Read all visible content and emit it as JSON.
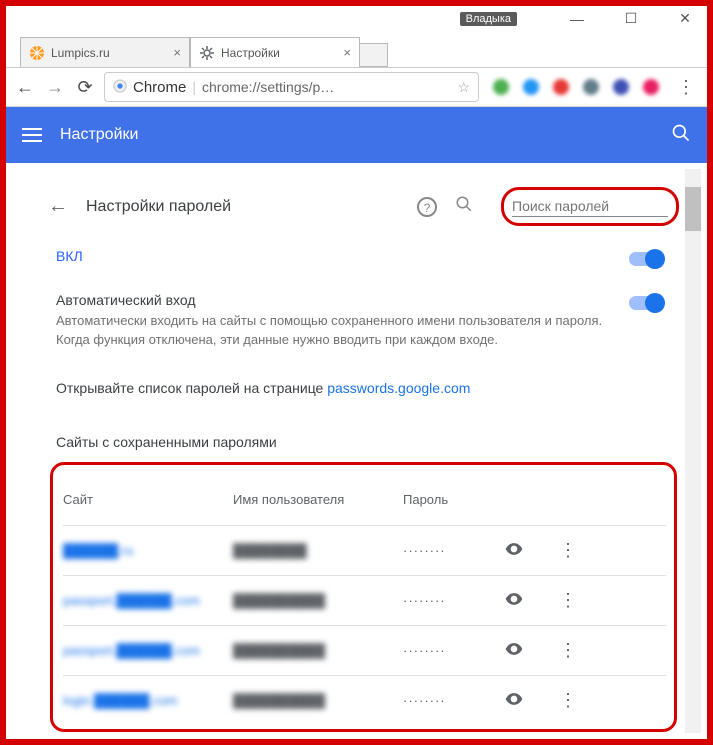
{
  "window": {
    "user_chip": "Владыка"
  },
  "tabs": [
    {
      "title": "Lumpics.ru",
      "favicon_color": "#ff9a1f"
    },
    {
      "title": "Настройки",
      "favicon_color": "#5f6368"
    }
  ],
  "addressbar": {
    "scheme_label": "Chrome",
    "url": "chrome://settings/p…"
  },
  "ext_colors": [
    "#4caf50",
    "#2196f3",
    "#e53935",
    "#607d8b",
    "#3f51b5",
    "#e91e63"
  ],
  "bluebar": {
    "title": "Настройки"
  },
  "subheader": {
    "title": "Настройки паролей",
    "search_placeholder": "Поиск паролей"
  },
  "toggles": {
    "on_label": "ВКЛ",
    "auto_login_title": "Автоматический вход",
    "auto_login_desc": "Автоматически входить на сайты с помощью сохраненного имени пользователя и пароля. Когда функция отключена, эти данные нужно вводить при каждом входе."
  },
  "link_row": {
    "prefix": "Открывайте список паролей на странице ",
    "link": "passwords.google.com"
  },
  "passwords": {
    "section_title": "Сайты с сохраненными паролями",
    "headers": {
      "site": "Сайт",
      "user": "Имя пользователя",
      "pass": "Пароль"
    },
    "mask": "········",
    "rows": [
      {
        "site": "██████.ru",
        "user": "████████"
      },
      {
        "site": "passport.██████.com",
        "user": "██████████"
      },
      {
        "site": "passport.██████.com",
        "user": "██████████"
      },
      {
        "site": "login.██████.com",
        "user": "██████████"
      }
    ]
  }
}
